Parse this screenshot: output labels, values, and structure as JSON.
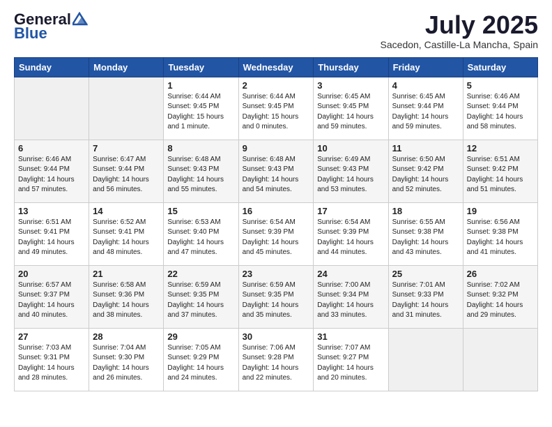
{
  "logo": {
    "general": "General",
    "blue": "Blue"
  },
  "title": "July 2025",
  "subtitle": "Sacedon, Castille-La Mancha, Spain",
  "headers": [
    "Sunday",
    "Monday",
    "Tuesday",
    "Wednesday",
    "Thursday",
    "Friday",
    "Saturday"
  ],
  "weeks": [
    [
      {
        "day": "",
        "info": ""
      },
      {
        "day": "",
        "info": ""
      },
      {
        "day": "1",
        "info": "Sunrise: 6:44 AM\nSunset: 9:45 PM\nDaylight: 15 hours\nand 1 minute."
      },
      {
        "day": "2",
        "info": "Sunrise: 6:44 AM\nSunset: 9:45 PM\nDaylight: 15 hours\nand 0 minutes."
      },
      {
        "day": "3",
        "info": "Sunrise: 6:45 AM\nSunset: 9:45 PM\nDaylight: 14 hours\nand 59 minutes."
      },
      {
        "day": "4",
        "info": "Sunrise: 6:45 AM\nSunset: 9:44 PM\nDaylight: 14 hours\nand 59 minutes."
      },
      {
        "day": "5",
        "info": "Sunrise: 6:46 AM\nSunset: 9:44 PM\nDaylight: 14 hours\nand 58 minutes."
      }
    ],
    [
      {
        "day": "6",
        "info": "Sunrise: 6:46 AM\nSunset: 9:44 PM\nDaylight: 14 hours\nand 57 minutes."
      },
      {
        "day": "7",
        "info": "Sunrise: 6:47 AM\nSunset: 9:44 PM\nDaylight: 14 hours\nand 56 minutes."
      },
      {
        "day": "8",
        "info": "Sunrise: 6:48 AM\nSunset: 9:43 PM\nDaylight: 14 hours\nand 55 minutes."
      },
      {
        "day": "9",
        "info": "Sunrise: 6:48 AM\nSunset: 9:43 PM\nDaylight: 14 hours\nand 54 minutes."
      },
      {
        "day": "10",
        "info": "Sunrise: 6:49 AM\nSunset: 9:43 PM\nDaylight: 14 hours\nand 53 minutes."
      },
      {
        "day": "11",
        "info": "Sunrise: 6:50 AM\nSunset: 9:42 PM\nDaylight: 14 hours\nand 52 minutes."
      },
      {
        "day": "12",
        "info": "Sunrise: 6:51 AM\nSunset: 9:42 PM\nDaylight: 14 hours\nand 51 minutes."
      }
    ],
    [
      {
        "day": "13",
        "info": "Sunrise: 6:51 AM\nSunset: 9:41 PM\nDaylight: 14 hours\nand 49 minutes."
      },
      {
        "day": "14",
        "info": "Sunrise: 6:52 AM\nSunset: 9:41 PM\nDaylight: 14 hours\nand 48 minutes."
      },
      {
        "day": "15",
        "info": "Sunrise: 6:53 AM\nSunset: 9:40 PM\nDaylight: 14 hours\nand 47 minutes."
      },
      {
        "day": "16",
        "info": "Sunrise: 6:54 AM\nSunset: 9:39 PM\nDaylight: 14 hours\nand 45 minutes."
      },
      {
        "day": "17",
        "info": "Sunrise: 6:54 AM\nSunset: 9:39 PM\nDaylight: 14 hours\nand 44 minutes."
      },
      {
        "day": "18",
        "info": "Sunrise: 6:55 AM\nSunset: 9:38 PM\nDaylight: 14 hours\nand 43 minutes."
      },
      {
        "day": "19",
        "info": "Sunrise: 6:56 AM\nSunset: 9:38 PM\nDaylight: 14 hours\nand 41 minutes."
      }
    ],
    [
      {
        "day": "20",
        "info": "Sunrise: 6:57 AM\nSunset: 9:37 PM\nDaylight: 14 hours\nand 40 minutes."
      },
      {
        "day": "21",
        "info": "Sunrise: 6:58 AM\nSunset: 9:36 PM\nDaylight: 14 hours\nand 38 minutes."
      },
      {
        "day": "22",
        "info": "Sunrise: 6:59 AM\nSunset: 9:35 PM\nDaylight: 14 hours\nand 37 minutes."
      },
      {
        "day": "23",
        "info": "Sunrise: 6:59 AM\nSunset: 9:35 PM\nDaylight: 14 hours\nand 35 minutes."
      },
      {
        "day": "24",
        "info": "Sunrise: 7:00 AM\nSunset: 9:34 PM\nDaylight: 14 hours\nand 33 minutes."
      },
      {
        "day": "25",
        "info": "Sunrise: 7:01 AM\nSunset: 9:33 PM\nDaylight: 14 hours\nand 31 minutes."
      },
      {
        "day": "26",
        "info": "Sunrise: 7:02 AM\nSunset: 9:32 PM\nDaylight: 14 hours\nand 29 minutes."
      }
    ],
    [
      {
        "day": "27",
        "info": "Sunrise: 7:03 AM\nSunset: 9:31 PM\nDaylight: 14 hours\nand 28 minutes."
      },
      {
        "day": "28",
        "info": "Sunrise: 7:04 AM\nSunset: 9:30 PM\nDaylight: 14 hours\nand 26 minutes."
      },
      {
        "day": "29",
        "info": "Sunrise: 7:05 AM\nSunset: 9:29 PM\nDaylight: 14 hours\nand 24 minutes."
      },
      {
        "day": "30",
        "info": "Sunrise: 7:06 AM\nSunset: 9:28 PM\nDaylight: 14 hours\nand 22 minutes."
      },
      {
        "day": "31",
        "info": "Sunrise: 7:07 AM\nSunset: 9:27 PM\nDaylight: 14 hours\nand 20 minutes."
      },
      {
        "day": "",
        "info": ""
      },
      {
        "day": "",
        "info": ""
      }
    ]
  ]
}
